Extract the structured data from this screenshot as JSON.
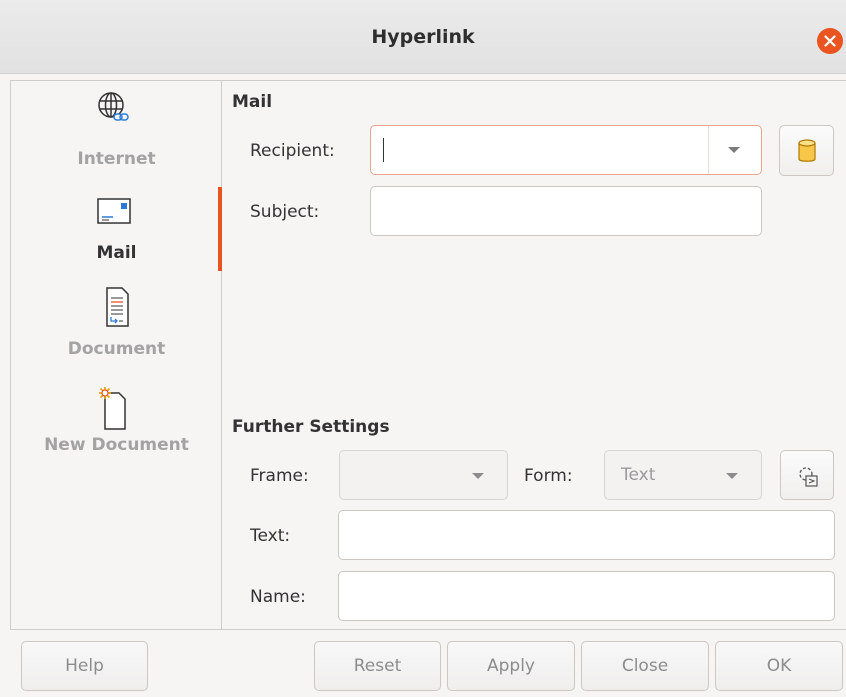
{
  "window": {
    "title": "Hyperlink"
  },
  "sidebar": {
    "items": [
      {
        "label": "Internet",
        "icon": "globe-link-icon",
        "state": "inactive"
      },
      {
        "label": "Mail",
        "icon": "mail-icon",
        "state": "active"
      },
      {
        "label": "Document",
        "icon": "document-icon",
        "state": "inactive"
      },
      {
        "label": "New Document",
        "icon": "new-document-icon",
        "state": "inactive"
      }
    ]
  },
  "mail": {
    "heading": "Mail",
    "recipient_label": "Recipient:",
    "recipient_value": "",
    "subject_label": "Subject:",
    "subject_value": "",
    "data_sources_icon": "database-icon"
  },
  "further": {
    "heading": "Further Settings",
    "frame_label": "Frame:",
    "frame_value": "",
    "form_label": "Form:",
    "form_value": "Text",
    "events_icon": "gear-macro-icon",
    "text_label": "Text:",
    "text_value": "",
    "name_label": "Name:",
    "name_value": ""
  },
  "buttons": {
    "help": "Help",
    "reset": "Reset",
    "apply": "Apply",
    "close": "Close",
    "ok": "OK"
  },
  "colors": {
    "accent": "#e95420",
    "close_button": "#e95420"
  }
}
